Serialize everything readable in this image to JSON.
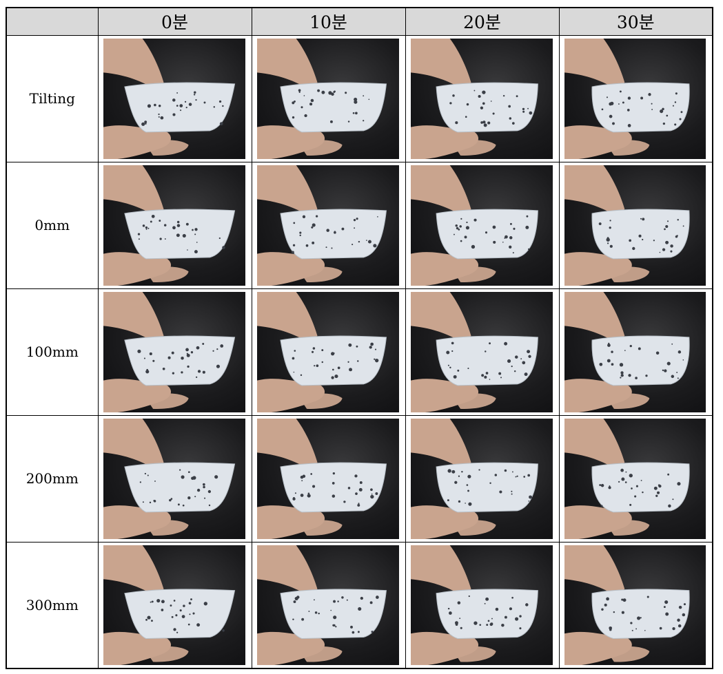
{
  "header": {
    "corner": "",
    "columns": [
      "0분",
      "10분",
      "20분",
      "30분"
    ]
  },
  "rows": [
    {
      "label": "Tilting"
    },
    {
      "label": "0mm"
    },
    {
      "label": "100mm"
    },
    {
      "label": "200mm"
    },
    {
      "label": "300mm"
    }
  ],
  "colors": {
    "header_bg": "#d9d9d9",
    "photo_bg": "#1b1b1d",
    "specimen": "#dfe4ea",
    "skin": "#c9a48e"
  },
  "icons": {
    "photo": "specimen-photo"
  }
}
